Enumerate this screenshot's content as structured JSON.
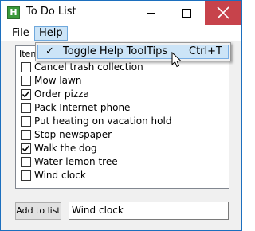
{
  "window": {
    "title": "To Do List",
    "app_icon_letter": "H"
  },
  "menubar": {
    "file": "File",
    "help": "Help"
  },
  "help_menu": {
    "items": [
      {
        "check": "✓",
        "label": "Toggle Help ToolTips",
        "shortcut": "Ctrl+T",
        "checked": true
      }
    ]
  },
  "list": {
    "header": "Iten",
    "items": [
      {
        "label": "Cancel trash collection",
        "checked": false
      },
      {
        "label": "Mow lawn",
        "checked": false
      },
      {
        "label": "Order pizza",
        "checked": true
      },
      {
        "label": "Pack Internet phone",
        "checked": false
      },
      {
        "label": "Put heating on vacation hold",
        "checked": false
      },
      {
        "label": "Stop newspaper",
        "checked": false
      },
      {
        "label": "Walk the dog",
        "checked": true
      },
      {
        "label": "Water lemon tree",
        "checked": false
      },
      {
        "label": "Wind clock",
        "checked": false
      }
    ]
  },
  "footer": {
    "add_button": "Add to list",
    "input_value": "Wind clock"
  },
  "colors": {
    "close_button": "#c7434b",
    "menu_highlight": "#cce4f7",
    "window_border": "#1c6fbe"
  },
  "icons": {
    "app": "app-icon",
    "minimize": "minimize-icon",
    "maximize": "maximize-icon",
    "close": "close-icon",
    "cursor": "mouse-pointer-icon"
  }
}
